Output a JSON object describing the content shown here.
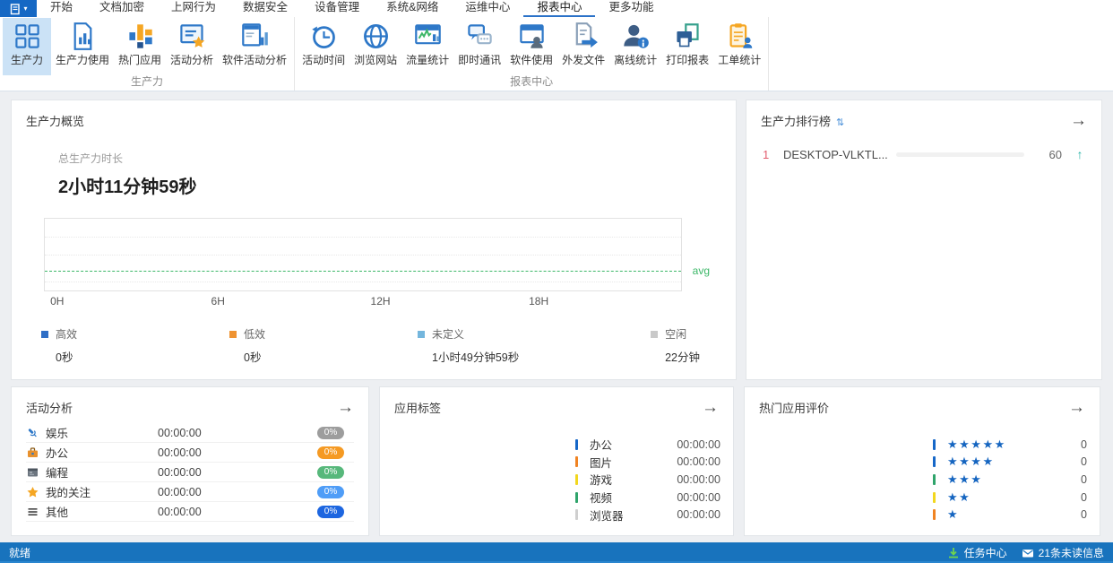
{
  "window": {
    "status": {
      "left": "就绪",
      "task_center": "任务中心",
      "unread": "21条未读信息"
    }
  },
  "tabs": {
    "items": [
      "开始",
      "文档加密",
      "上网行为",
      "数据安全",
      "设备管理",
      "系统&网络",
      "运维中心",
      "报表中心",
      "更多功能"
    ],
    "active_index": 7
  },
  "ribbon": {
    "groups": [
      {
        "label": "生产力",
        "items": [
          {
            "label": "生产力",
            "icon": "productivity-icon",
            "selected": true
          },
          {
            "label": "生产力使用",
            "icon": "productivity-usage-icon"
          },
          {
            "label": "热门应用",
            "icon": "hot-apps-icon"
          },
          {
            "label": "活动分析",
            "icon": "activity-analysis-icon"
          },
          {
            "label": "软件活动分析",
            "icon": "software-activity-icon"
          }
        ]
      },
      {
        "label": "报表中心",
        "items": [
          {
            "label": "活动时间",
            "icon": "activity-time-icon"
          },
          {
            "label": "浏览网站",
            "icon": "browse-website-icon"
          },
          {
            "label": "流量统计",
            "icon": "traffic-stats-icon"
          },
          {
            "label": "即时通讯",
            "icon": "im-icon"
          },
          {
            "label": "软件使用",
            "icon": "software-usage-icon"
          },
          {
            "label": "外发文件",
            "icon": "outgoing-files-icon"
          },
          {
            "label": "离线统计",
            "icon": "offline-stats-icon"
          },
          {
            "label": "打印报表",
            "icon": "print-report-icon"
          },
          {
            "label": "工单统计",
            "icon": "ticket-stats-icon"
          }
        ]
      }
    ]
  },
  "overview": {
    "title": "生产力概览",
    "total_label": "总生产力时长",
    "total_value": "2小时11分钟59秒",
    "chart_data": {
      "type": "area",
      "x_ticks": [
        "0H",
        "6H",
        "12H",
        "18H"
      ],
      "x_tick_positions_pct": [
        1,
        26.2,
        51.2,
        76
      ],
      "x_range": [
        "0H",
        "24H"
      ],
      "series": [],
      "avg_label": "avg",
      "avg_color": "#3cb768",
      "avg_line_pct_from_top": 72,
      "grid": true
    },
    "legend": [
      {
        "label": "高效",
        "value": "0秒",
        "color": "#2f6fc6"
      },
      {
        "label": "低效",
        "value": "0秒",
        "color": "#ef9331"
      },
      {
        "label": "未定义",
        "value": "1小时49分钟59秒",
        "color": "#74b6dd"
      },
      {
        "label": "空闲",
        "value": "22分钟",
        "color": "#c9c9c9"
      }
    ]
  },
  "ranking": {
    "title": "生产力排行榜",
    "rows": [
      {
        "rank": "1",
        "name": "DESKTOP-VLKTL...",
        "score": "60",
        "bar_pct": 78,
        "trend": "up"
      }
    ]
  },
  "activity": {
    "title": "活动分析",
    "rows": [
      {
        "icon": "entertainment-icon",
        "label": "娱乐",
        "time": "00:00:00",
        "pct": "0%",
        "badge_color": "#9d9d9d"
      },
      {
        "icon": "office-icon",
        "label": "办公",
        "time": "00:00:00",
        "pct": "0%",
        "badge_color": "#f59a23"
      },
      {
        "icon": "coding-icon",
        "label": "编程",
        "time": "00:00:00",
        "pct": "0%",
        "badge_color": "#57b87b"
      },
      {
        "icon": "my-focus-icon",
        "label": "我的关注",
        "time": "00:00:00",
        "pct": "0%",
        "badge_color": "#4f9df7"
      },
      {
        "icon": "other-icon",
        "label": "其他",
        "time": "00:00:00",
        "pct": "0%",
        "badge_color": "#1d66e0"
      }
    ]
  },
  "app_tags": {
    "title": "应用标签",
    "rows": [
      {
        "label": "办公",
        "time": "00:00:00",
        "color": "#1667c8"
      },
      {
        "label": "图片",
        "time": "00:00:00",
        "color": "#f08322"
      },
      {
        "label": "游戏",
        "time": "00:00:00",
        "color": "#f2d71e"
      },
      {
        "label": "视频",
        "time": "00:00:00",
        "color": "#2fa46b"
      },
      {
        "label": "浏览器",
        "time": "00:00:00",
        "color": "#cfcfcf"
      }
    ]
  },
  "ratings": {
    "title": "热门应用评价",
    "star_color": "#1565c0",
    "rows": [
      {
        "stars": 5,
        "count": "0",
        "color": "#1667c8"
      },
      {
        "stars": 4,
        "count": "0",
        "color": "#1667c8"
      },
      {
        "stars": 3,
        "count": "0",
        "color": "#2fa46b"
      },
      {
        "stars": 2,
        "count": "0",
        "color": "#f2d71e"
      },
      {
        "stars": 1,
        "count": "0",
        "color": "#f08322"
      }
    ]
  }
}
